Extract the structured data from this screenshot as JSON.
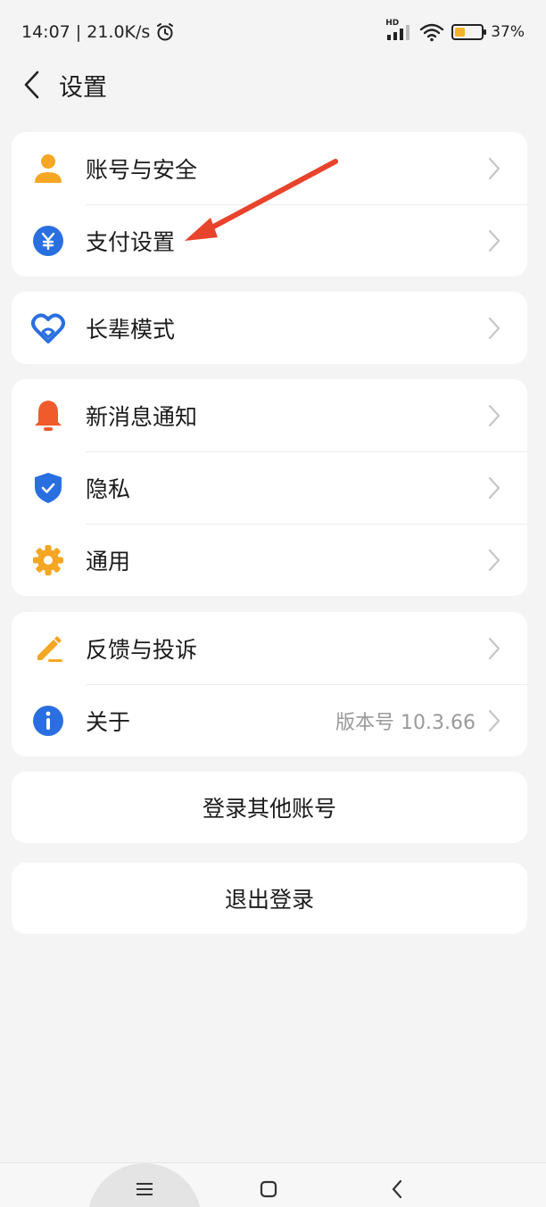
{
  "status_bar": {
    "time_speed": "14:07 | 21.0K/s",
    "hd_label": "HD",
    "battery_percent": "37%",
    "battery_level": 0.37
  },
  "header": {
    "title": "设置"
  },
  "groups": {
    "g1": [
      {
        "label": "账号与安全",
        "icon": "person-icon"
      },
      {
        "label": "支付设置",
        "icon": "yuan-icon"
      }
    ],
    "g2": [
      {
        "label": "长辈模式",
        "icon": "heart-icon"
      }
    ],
    "g3": [
      {
        "label": "新消息通知",
        "icon": "bell-icon"
      },
      {
        "label": "隐私",
        "icon": "shield-check-icon"
      },
      {
        "label": "通用",
        "icon": "gear-icon"
      }
    ],
    "g4": [
      {
        "label": "反馈与投诉",
        "icon": "pen-icon"
      },
      {
        "label": "关于",
        "icon": "info-icon",
        "value": "版本号 10.3.66"
      }
    ]
  },
  "buttons": {
    "switch_account": "登录其他账号",
    "logout": "退出登录"
  },
  "colors": {
    "accent_blue": "#2a6fe0",
    "orange": "#f5a623",
    "red_orange": "#f15a2b",
    "annotation_red": "#e8432b"
  }
}
